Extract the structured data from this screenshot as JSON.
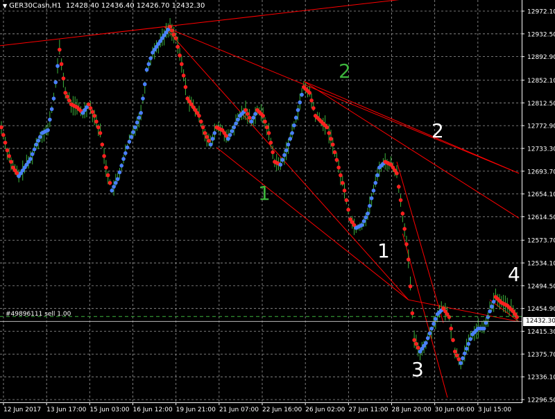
{
  "window": {
    "symbol_timeframe": "GER30Cash,H1",
    "ohlc": "12428.40 12436.40 12426.70 12432.30",
    "header_icon": "triangle-down-icon"
  },
  "order_line": {
    "label": "#49896111 sell 1.00",
    "price": 12441
  },
  "current_price": {
    "label": "12432.30",
    "value": 12432.3
  },
  "colors": {
    "background": "#000000",
    "grid": "#9a9a9a",
    "candle": "#3cb43c",
    "trend_lines": "#ff0000",
    "up_dots": "#4a7fff",
    "down_dots": "#ff2020",
    "order_line": "#3cb43c",
    "label_green": "#3cb43c",
    "label_white": "#ffffff"
  },
  "wave_labels": [
    {
      "text": "2",
      "color": "green"
    },
    {
      "text": "2",
      "color": "white"
    },
    {
      "text": "1",
      "color": "green"
    },
    {
      "text": "1",
      "color": "white"
    },
    {
      "text": "4",
      "color": "white"
    },
    {
      "text": "3",
      "color": "white"
    }
  ],
  "chart_data": {
    "type": "line",
    "y_axis_position": "right",
    "ylim": [
      12279,
      12994
    ],
    "y_ticks": [
      "12972.10",
      "12932.50",
      "12892.90",
      "12852.10",
      "12812.50",
      "12772.90",
      "12733.30",
      "12693.70",
      "12654.10",
      "12614.50",
      "12573.70",
      "12534.10",
      "12494.50",
      "12454.90",
      "12415.30",
      "12375.70",
      "12336.10",
      "12296.50"
    ],
    "x_ticks": [
      "12 Jun 2017",
      "13 Jun 17:00",
      "15 Jun 03:00",
      "16 Jun 12:00",
      "19 Jun 21:00",
      "21 Jun 07:00",
      "22 Jun 16:00",
      "26 Jun 02:00",
      "27 Jun 11:00",
      "28 Jun 20:00",
      "30 Jun 06:00",
      "3 Jul 15:00"
    ],
    "grid": true,
    "series": [
      {
        "values": [
          12770,
          12730,
          12700,
          12685,
          12700,
          12715,
          12740,
          12760,
          12765,
          12820,
          12905,
          12830,
          12810,
          12805,
          12795,
          12810,
          12790,
          12760,
          12700,
          12660,
          12680,
          12715,
          12745,
          12770,
          12795,
          12870,
          12900,
          12915,
          12930,
          12945,
          12925,
          12880,
          12820,
          12805,
          12790,
          12760,
          12740,
          12770,
          12765,
          12750,
          12770,
          12790,
          12800,
          12780,
          12800,
          12790,
          12760,
          12710,
          12705,
          12730,
          12760,
          12800,
          12840,
          12830,
          12790,
          12780,
          12770,
          12740,
          12700,
          12660,
          12610,
          12595,
          12600,
          12620,
          12660,
          12700,
          12710,
          12705,
          12690,
          12620,
          12540,
          12400,
          12380,
          12395,
          12420,
          12445,
          12455,
          12440,
          12380,
          12360,
          12385,
          12410,
          12420,
          12420,
          12450,
          12475,
          12465,
          12460,
          12450,
          12435
        ]
      }
    ],
    "trend_lines_count": 10
  }
}
